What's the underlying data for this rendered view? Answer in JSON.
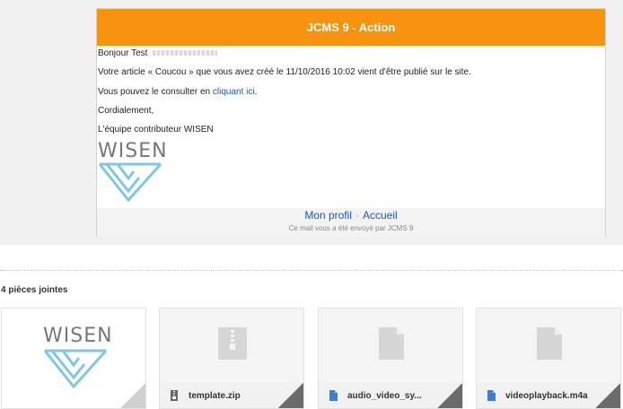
{
  "mail": {
    "header_title": "JCMS 9 - Action",
    "greeting": "Bonjour Test",
    "line1": "Votre article « Coucou » que vous avez créé le 11/10/2016 10:02 vient d'être publié sur le site.",
    "line2_prefix": "Vous pouvez le consulter en ",
    "line2_link": "cliquant ici",
    "line2_suffix": ".",
    "closing": "Cordialement,",
    "signature": "L'équipe contributeur WISEN",
    "logo_text": "WISEN",
    "footer_profile": "Mon profil",
    "footer_separator": "·",
    "footer_home": "Accueil",
    "footer_note": "Ce mail vous a été envoyé par JCMS 9"
  },
  "attachments": {
    "title": "4 pièces jointes",
    "items": [
      {
        "name": "",
        "icon": "image-preview"
      },
      {
        "name": "template.zip",
        "icon": "zip-icon"
      },
      {
        "name": "audio_video_sy...",
        "icon": "doc-icon"
      },
      {
        "name": "videoplayback.m4a",
        "icon": "doc-icon"
      }
    ]
  },
  "colors": {
    "header": "#f7930f",
    "link": "#1a56c4",
    "logo_blue": "#7fc6e6",
    "file_icon_blue": "#3b7dd8"
  }
}
